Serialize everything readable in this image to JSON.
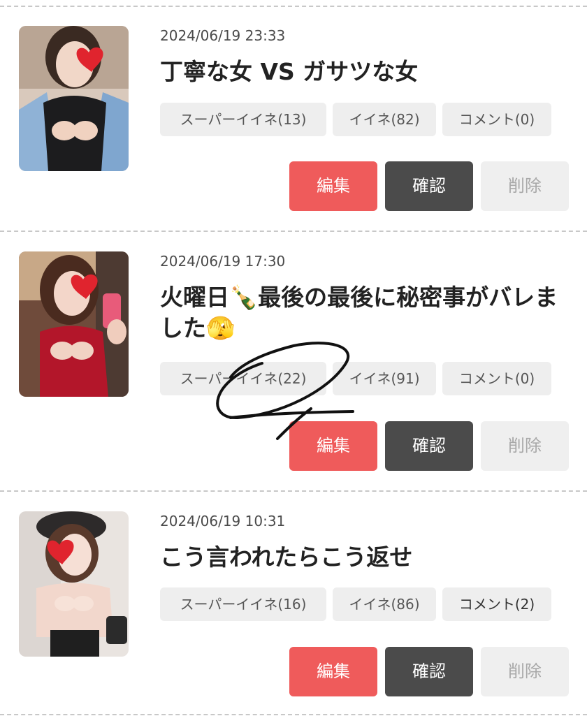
{
  "posts": [
    {
      "date": "2024/06/19 23:33",
      "title": "丁寧な女 VS ガサツな女",
      "super_like": "スーパーイイネ(13)",
      "like": "イイネ(82)",
      "comment": "コメント(0)"
    },
    {
      "date": "2024/06/19 17:30",
      "title": "火曜日🍾最後の最後に秘密事がバレました🫣",
      "super_like": "スーパーイイネ(22)",
      "like": "イイネ(91)",
      "comment": "コメント(0)"
    },
    {
      "date": "2024/06/19 10:31",
      "title": "こう言われたらこう返せ",
      "super_like": "スーパーイイネ(16)",
      "like": "イイネ(86)",
      "comment": "コメント(2)"
    }
  ],
  "buttons": {
    "edit": "編集",
    "confirm": "確認",
    "delete": "削除"
  },
  "colors": {
    "edit": "#ef5b5b",
    "confirm": "#4b4b4b",
    "delete": "#efefef",
    "tag_bg": "#eeeeee"
  }
}
